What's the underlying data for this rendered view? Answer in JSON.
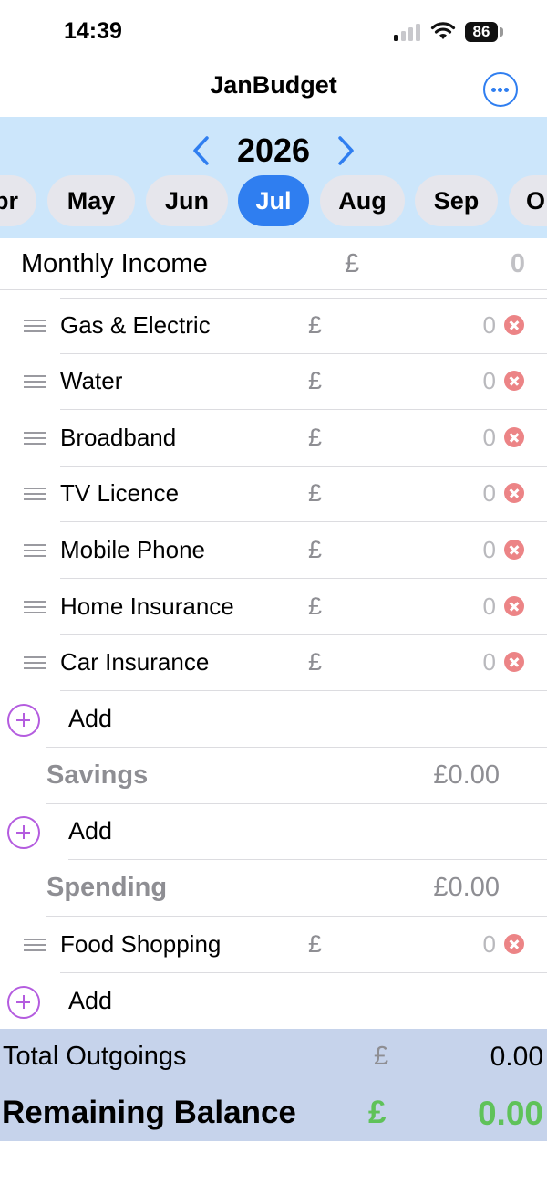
{
  "status_bar": {
    "time": "14:39",
    "battery": "86"
  },
  "app": {
    "title": "JanBudget",
    "accent_color": "#2f7ef0",
    "add_color": "#b45cdf",
    "balance_color": "#5fc259"
  },
  "year_selector": {
    "year": "2026",
    "prev_icon": "chevron-left-icon",
    "next_icon": "chevron-right-icon"
  },
  "months": [
    "Apr",
    "May",
    "Jun",
    "Jul",
    "Aug",
    "Sep",
    "Oct"
  ],
  "months_display": [
    "pr",
    "May",
    "Jun",
    "Jul",
    "Aug",
    "Sep",
    "O"
  ],
  "selected_month": "Jul",
  "income": {
    "label": "Monthly Income",
    "currency": "£",
    "value": "0"
  },
  "bills": {
    "items": [
      {
        "label": "Gas & Electric",
        "currency": "£",
        "value": "0"
      },
      {
        "label": "Water",
        "currency": "£",
        "value": "0"
      },
      {
        "label": "Broadband",
        "currency": "£",
        "value": "0"
      },
      {
        "label": "TV Licence",
        "currency": "£",
        "value": "0"
      },
      {
        "label": "Mobile Phone",
        "currency": "£",
        "value": "0"
      },
      {
        "label": "Home Insurance",
        "currency": "£",
        "value": "0"
      },
      {
        "label": "Car Insurance",
        "currency": "£",
        "value": "0"
      }
    ],
    "add_label": "Add"
  },
  "savings": {
    "title": "Savings",
    "total": "£0.00",
    "add_label": "Add"
  },
  "spending": {
    "title": "Spending",
    "total": "£0.00",
    "items": [
      {
        "label": "Food Shopping",
        "currency": "£",
        "value": "0"
      }
    ],
    "add_label": "Add"
  },
  "totals": {
    "outgoings_label": "Total Outgoings",
    "outgoings_currency": "£",
    "outgoings_value": "0.00",
    "balance_label": "Remaining Balance",
    "balance_currency": "£",
    "balance_value": "0.00"
  }
}
